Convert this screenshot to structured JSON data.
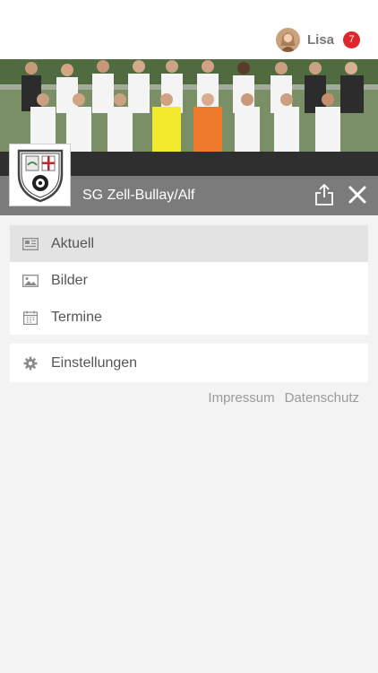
{
  "header": {
    "user_name": "Lisa",
    "notification_count": "7"
  },
  "club": {
    "name": "SG Zell-Bullay/Alf"
  },
  "menu": {
    "items": [
      {
        "label": "Aktuell",
        "icon": "newspaper-icon",
        "active": true
      },
      {
        "label": "Bilder",
        "icon": "image-icon",
        "active": false
      },
      {
        "label": "Termine",
        "icon": "calendar-icon",
        "active": false
      }
    ],
    "settings_label": "Einstellungen"
  },
  "footer": {
    "impressum": "Impressum",
    "datenschutz": "Datenschutz"
  },
  "colors": {
    "badge": "#e0262b",
    "club_bar": "#7b7b7b",
    "active_item": "#e3e3e3"
  }
}
